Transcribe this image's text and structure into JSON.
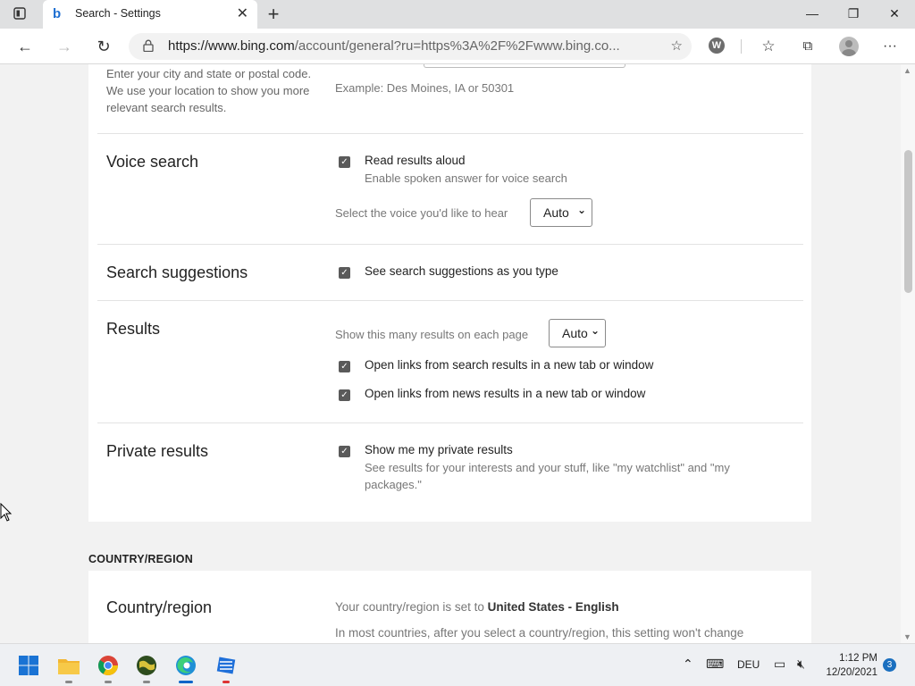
{
  "browser": {
    "tab_title": "Search - Settings",
    "url_main": "https://www.bing.com",
    "url_rest": "/account/general?ru=https%3A%2F%2Fwww.bing.co...",
    "new_tab_symbol": "+",
    "ext_letter": "W"
  },
  "location": {
    "description": "Enter your city and state or postal code. We use your location to show you more relevant search results.",
    "example": "Example: Des Moines, IA or 50301"
  },
  "voice_search": {
    "title": "Voice search",
    "read_aloud_label": "Read results aloud",
    "read_aloud_sub": "Enable spoken answer for voice search",
    "read_aloud_checked": true,
    "voice_label": "Select the voice you'd like to hear",
    "voice_value": "Auto"
  },
  "search_suggestions": {
    "title": "Search suggestions",
    "label": "See search suggestions as you type",
    "checked": true
  },
  "results": {
    "title": "Results",
    "count_label": "Show this many results on each page",
    "count_value": "Auto",
    "open_search_new_tab": "Open links from search results in a new tab or window",
    "open_news_new_tab": "Open links from news results in a new tab or window"
  },
  "private_results": {
    "title": "Private results",
    "label": "Show me my private results",
    "sub": "See results for your interests and your stuff, like \"my watchlist\" and \"my packages.\""
  },
  "country_region_heading": "COUNTRY/REGION",
  "country_region": {
    "title": "Country/region",
    "set_to_prefix": "Your country/region is set to",
    "set_to_value": "United States - English",
    "note": "In most countries, after you select a country/region, this setting won't change"
  },
  "taskbar": {
    "language": "DEU",
    "time": "1:12 PM",
    "date": "12/20/2021",
    "notifications": "3"
  }
}
